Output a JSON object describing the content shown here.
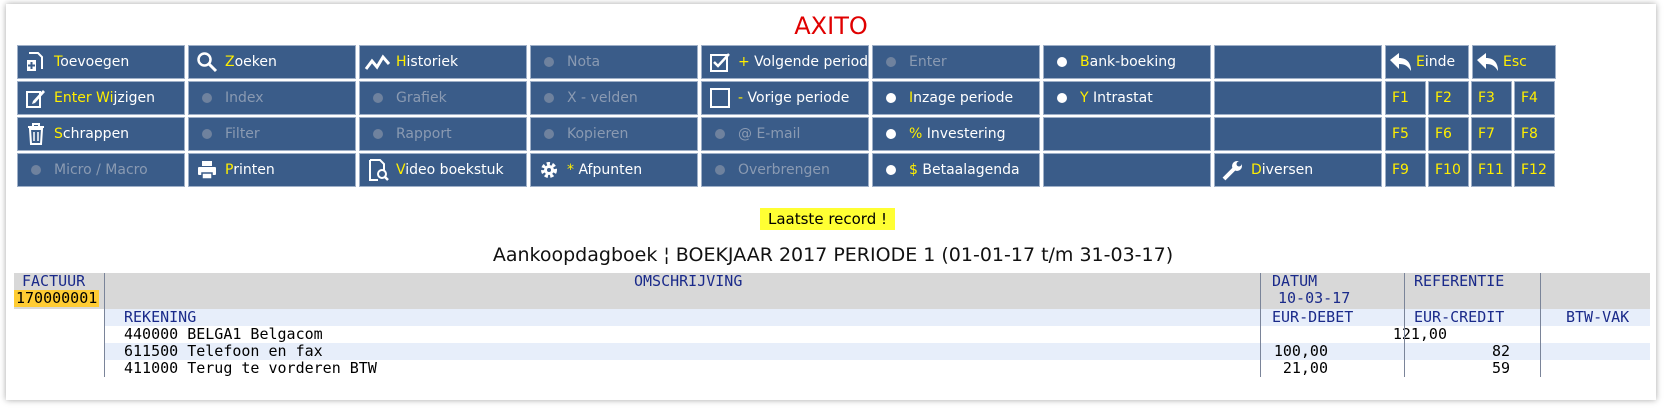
{
  "app": {
    "title": "AXITO"
  },
  "colors": {
    "button_bg": "#3a5c89",
    "hotkey": "#ffee00",
    "title": "#e00000",
    "badge": "#ffff33"
  },
  "buttons": [
    {
      "name": "toevoegen-button",
      "hk": "T",
      "rest": "oevoegen",
      "icon": "add-doc-icon",
      "enabled": true
    },
    {
      "name": "zoeken-button",
      "hk": "Z",
      "rest": "oeken",
      "icon": "search-icon",
      "enabled": true
    },
    {
      "name": "historiek-button",
      "hk": "H",
      "rest": "istoriek",
      "icon": "line-chart-icon",
      "enabled": true
    },
    {
      "name": "nota-button",
      "hk": "",
      "rest": "Nota",
      "icon": "dot-icon",
      "enabled": false
    },
    {
      "name": "volgende-periode-button",
      "hk": "+",
      "rest": " Volgende periode",
      "icon": "checkbox-checked-icon",
      "enabled": true
    },
    {
      "name": "enter-button",
      "hk": "",
      "rest": "Enter",
      "icon": "dot-icon",
      "enabled": false
    },
    {
      "name": "bank-boeking-button",
      "hk": "B",
      "rest": "ank-boeking",
      "icon": "dot-icon",
      "enabled": true
    },
    {
      "name": "empty-button-1",
      "hk": "",
      "rest": "",
      "icon": "",
      "enabled": true
    },
    {
      "name": "einde-button",
      "hk": "E",
      "rest": "inde",
      "icon": "back-arrow-icon",
      "enabled": true
    },
    {
      "name": "esc-button",
      "hk": "Esc",
      "rest": "",
      "icon": "back-arrow-icon",
      "enabled": true
    },
    {
      "name": "wijzigen-button",
      "hk": "Enter Wi",
      "rest": "jzigen",
      "icon": "edit-icon",
      "enabled": true
    },
    {
      "name": "index-button",
      "hk": "",
      "rest": "Index",
      "icon": "dot-icon",
      "enabled": false
    },
    {
      "name": "grafiek-button",
      "hk": "",
      "rest": "Grafiek",
      "icon": "dot-icon",
      "enabled": false
    },
    {
      "name": "x-velden-button",
      "hk": "",
      "rest": "X - velden",
      "icon": "dot-icon",
      "enabled": false
    },
    {
      "name": "vorige-periode-button",
      "hk": "-",
      "rest": " Vorige periode",
      "icon": "checkbox-empty-icon",
      "enabled": true
    },
    {
      "name": "inzage-periode-button",
      "hk": "I",
      "rest": "nzage periode",
      "icon": "dot-icon",
      "enabled": true
    },
    {
      "name": "intrastat-button",
      "hk": "Y",
      "rest": " Intrastat",
      "icon": "dot-icon",
      "enabled": true
    },
    {
      "name": "empty-button-2",
      "hk": "",
      "rest": "",
      "icon": "",
      "enabled": true
    },
    {
      "name": "schrappen-button",
      "hk": "S",
      "rest": "chrappen",
      "icon": "trash-icon",
      "enabled": true
    },
    {
      "name": "filter-button",
      "hk": "",
      "rest": "Filter",
      "icon": "dot-icon",
      "enabled": false
    },
    {
      "name": "rapport-button",
      "hk": "",
      "rest": "Rapport",
      "icon": "dot-icon",
      "enabled": false
    },
    {
      "name": "kopieren-button",
      "hk": "",
      "rest": "Kopieren",
      "icon": "dot-icon",
      "enabled": false
    },
    {
      "name": "email-button",
      "hk": "",
      "rest": "@ E-mail",
      "icon": "dot-icon",
      "enabled": false
    },
    {
      "name": "investering-button",
      "hk": "%",
      "rest": " Investering",
      "icon": "dot-icon",
      "enabled": true
    },
    {
      "name": "empty-button-3",
      "hk": "",
      "rest": "",
      "icon": "",
      "enabled": true
    },
    {
      "name": "empty-button-4",
      "hk": "",
      "rest": "",
      "icon": "",
      "enabled": true
    },
    {
      "name": "micro-macro-button",
      "hk": "",
      "rest": "Micro / Macro",
      "icon": "dot-icon",
      "enabled": false
    },
    {
      "name": "printen-button",
      "hk": "P",
      "rest": "rinten",
      "icon": "printer-icon",
      "enabled": true
    },
    {
      "name": "video-boekstuk-button",
      "hk": "V",
      "rest": "ideo boekstuk",
      "icon": "document-search-icon",
      "enabled": true
    },
    {
      "name": "afpunten-button",
      "hk": "*",
      "rest": " Afpunten",
      "icon": "gear-icon",
      "enabled": true
    },
    {
      "name": "overbrengen-button",
      "hk": "",
      "rest": "Overbrengen",
      "icon": "dot-icon",
      "enabled": false
    },
    {
      "name": "betaalagenda-button",
      "hk": "$",
      "rest": " Betaalagenda",
      "icon": "dot-icon",
      "enabled": true
    },
    {
      "name": "empty-button-5",
      "hk": "",
      "rest": "",
      "icon": "",
      "enabled": true
    },
    {
      "name": "diversen-button",
      "hk": "D",
      "rest": "iversen",
      "icon": "wrench-icon",
      "enabled": true
    }
  ],
  "fkeys": [
    "F1",
    "F2",
    "F3",
    "F4",
    "F5",
    "F6",
    "F7",
    "F8",
    "F9",
    "F10",
    "F11",
    "F12"
  ],
  "status": {
    "badge": "Laatste record  !"
  },
  "journal": {
    "header": "Aankoopdagboek ¦ BOEKJAAR 2017 PERIODE 1 (01-01-17 t/m 31-03-17)"
  },
  "table": {
    "headers": {
      "factuur": "FACTUUR",
      "omschrijving": "OMSCHRIJVING",
      "datum": "DATUM",
      "referentie": "REFERENTIE",
      "rekening": "REKENING",
      "eur_debet": "EUR-DEBET",
      "eur_credit": "EUR-CREDIT",
      "btw_vak": "BTW-VAK"
    },
    "record": {
      "factuur": "170000001",
      "datum": "10-03-17"
    },
    "lines": [
      {
        "rekening": "440000 BELGA1 Belgacom",
        "debet": "",
        "credit": "121,00",
        "btw": ""
      },
      {
        "rekening": "611500 Telefoon en fax",
        "debet": "100,00",
        "credit": "",
        "btw": "82"
      },
      {
        "rekening": "411000 Terug te vorderen BTW",
        "debet": "21,00",
        "credit": "",
        "btw": "59"
      }
    ]
  }
}
